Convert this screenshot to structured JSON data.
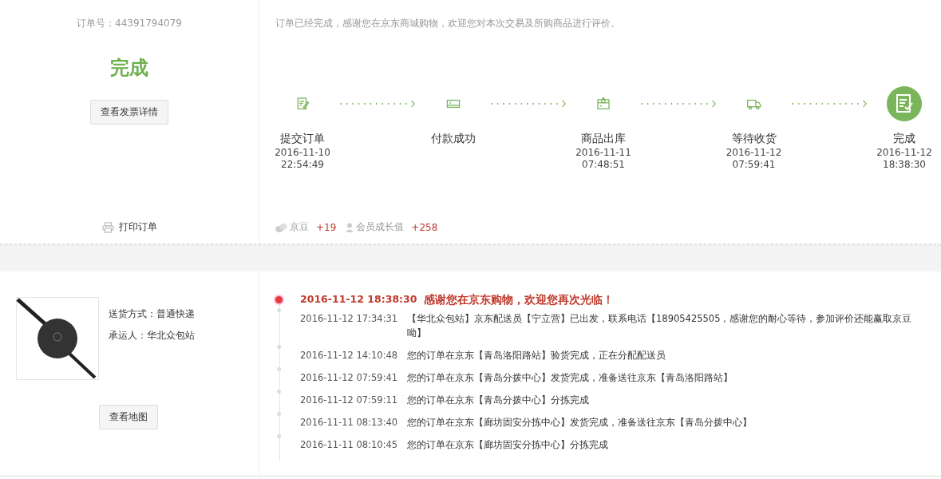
{
  "order": {
    "number_label": "订单号：44391794079",
    "status": "完成",
    "invoice_button": "查看发票详情",
    "print_label": "打印订单"
  },
  "notice": "订单已经完成，感谢您在京东商城购物，欢迎您对本次交易及所购商品进行评价。",
  "steps": [
    {
      "kind": "order",
      "label": "提交订单",
      "date": "2016-11-10",
      "time": "22:54:49",
      "current": false
    },
    {
      "kind": "payment",
      "label": "付款成功",
      "current": false
    },
    {
      "kind": "outbound",
      "label": "商品出库",
      "date": "2016-11-11",
      "time": "07:48:51",
      "current": false
    },
    {
      "kind": "delivery",
      "label": "等待收货",
      "date": "2016-11-12",
      "time": "07:59:41",
      "current": false
    },
    {
      "kind": "complete",
      "label": "完成",
      "date": "2016-11-12",
      "time": "18:38:30",
      "current": true
    }
  ],
  "rewards": [
    {
      "kind": "beans",
      "label": "京豆",
      "value": "+19"
    },
    {
      "kind": "member",
      "label": "会员成长值",
      "value": "+258"
    }
  ],
  "shipping": {
    "method": "送货方式：普通快递",
    "carrier": "承运人：华北众包站",
    "map_button": "查看地图"
  },
  "tracking": [
    {
      "time": "2016-11-12 18:38:30",
      "text": "感谢您在京东购物，欢迎您再次光临！",
      "latest": true
    },
    {
      "time": "2016-11-12 17:34:31",
      "text": "【华北众包站】京东配送员【宁立营】已出发，联系电话【18905425505，感谢您的耐心等待，参加评价还能赢取京豆呦】",
      "latest": false
    },
    {
      "time": "2016-11-12 14:10:48",
      "text": "您的订单在京东【青岛洛阳路站】验货完成，正在分配配送员",
      "latest": false
    },
    {
      "time": "2016-11-12 07:59:41",
      "text": "您的订单在京东【青岛分拨中心】发货完成，准备送往京东【青岛洛阳路站】",
      "latest": false
    },
    {
      "time": "2016-11-12 07:59:11",
      "text": "您的订单在京东【青岛分拨中心】分拣完成",
      "latest": false
    },
    {
      "time": "2016-11-11 08:13:40",
      "text": "您的订单在京东【廊坊固安分拣中心】发货完成，准备送往京东【青岛分拨中心】",
      "latest": false
    },
    {
      "time": "2016-11-11 08:10:45",
      "text": "您的订单在京东【廊坊固安分拣中心】分拣完成",
      "latest": false
    }
  ]
}
